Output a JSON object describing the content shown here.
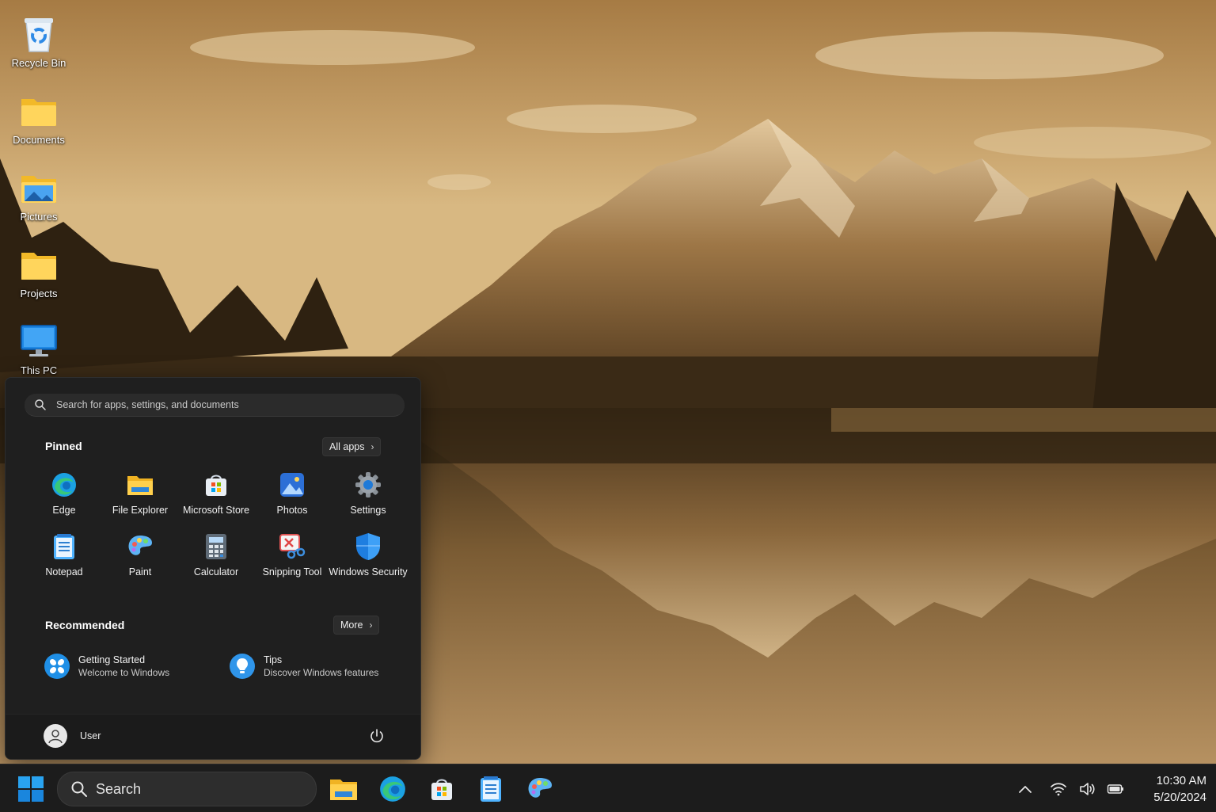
{
  "desktop": {
    "icons": [
      {
        "label": "Recycle Bin",
        "icon": "recycle-bin-icon"
      },
      {
        "label": "Documents",
        "icon": "folder-icon"
      },
      {
        "label": "Pictures",
        "icon": "pictures-folder-icon"
      },
      {
        "label": "Projects",
        "icon": "folder-icon"
      },
      {
        "label": "This PC",
        "icon": "monitor-icon"
      }
    ]
  },
  "start_menu": {
    "search_placeholder": "Search for apps, settings, and documents",
    "pinned": {
      "title": "Pinned",
      "all_apps_label": "All apps",
      "apps": [
        {
          "label": "Edge",
          "icon": "edge-icon"
        },
        {
          "label": "File Explorer",
          "icon": "file-explorer-icon"
        },
        {
          "label": "Microsoft Store",
          "icon": "store-icon"
        },
        {
          "label": "Photos",
          "icon": "photos-icon"
        },
        {
          "label": "Settings",
          "icon": "settings-gear-icon"
        },
        {
          "label": "Notepad",
          "icon": "notepad-icon"
        },
        {
          "label": "Paint",
          "icon": "paint-icon"
        },
        {
          "label": "Calculator",
          "icon": "calculator-icon"
        },
        {
          "label": "Snipping Tool",
          "icon": "snipping-tool-icon"
        },
        {
          "label": "Windows Security",
          "icon": "shield-icon"
        }
      ]
    },
    "recommended": {
      "title": "Recommended",
      "more_label": "More",
      "items": [
        {
          "title": "Getting Started",
          "subtitle": "Welcome to Windows",
          "icon": "getting-started-icon"
        },
        {
          "title": "Tips",
          "subtitle": "Discover Windows features",
          "icon": "tips-icon"
        }
      ]
    },
    "user": {
      "name": "User"
    }
  },
  "taskbar": {
    "search_label": "Search",
    "pinned_apps": [
      "file-explorer-icon",
      "edge-icon",
      "store-icon",
      "notepad-icon",
      "paint-icon"
    ],
    "tray": [
      "chevron-up-icon",
      "wifi-icon",
      "volume-icon",
      "battery-icon"
    ],
    "time": "10:30 AM",
    "date": "5/20/2024"
  },
  "colors": {
    "start_menu_bg": "#1f1f1f",
    "taskbar_bg": "#1c1c1c",
    "accent": "#0078d4",
    "wallpaper_tone": "#b88e55"
  }
}
